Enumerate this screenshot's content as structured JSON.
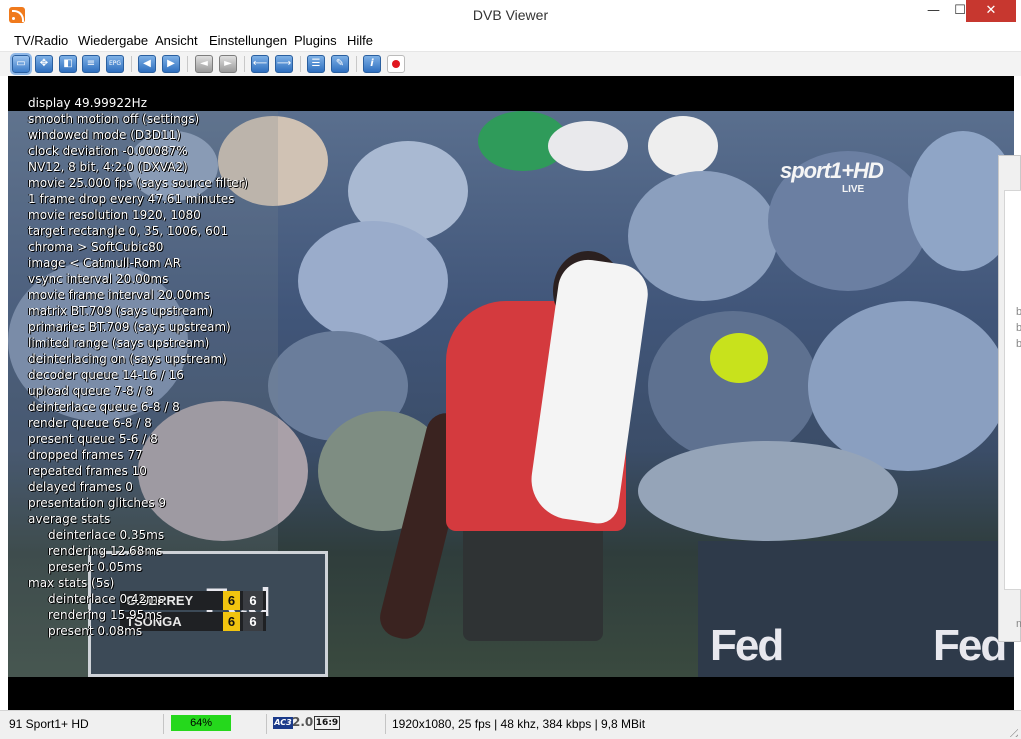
{
  "window": {
    "title": "DVB Viewer",
    "controls": {
      "minimize": "—",
      "maximize": "☐",
      "close": "✕"
    }
  },
  "menu": [
    "TV/Radio",
    "Wiedergabe",
    "Ansicht",
    "Einstellungen",
    "Plugins",
    "Hilfe"
  ],
  "toolbar": {
    "buttons": [
      {
        "icon": "window-mode-icon",
        "glyph": "▭"
      },
      {
        "icon": "fullscreen-icon",
        "glyph": "✥"
      },
      {
        "icon": "desktop-icon",
        "glyph": "◧"
      },
      {
        "icon": "osd-icon",
        "glyph": "≡"
      },
      {
        "icon": "epg-icon",
        "glyph": "EPG"
      },
      {
        "icon": "previous-channel-icon",
        "glyph": "◀"
      },
      {
        "icon": "next-channel-icon",
        "glyph": "▶"
      },
      {
        "icon": "audio-down-icon",
        "glyph": "◄"
      },
      {
        "icon": "audio-up-icon",
        "glyph": "►"
      },
      {
        "icon": "back-icon",
        "glyph": "⟵"
      },
      {
        "icon": "forward-icon",
        "glyph": "⟶"
      },
      {
        "icon": "channel-list-icon",
        "glyph": "☰"
      },
      {
        "icon": "options-icon",
        "glyph": "✎"
      },
      {
        "icon": "info-icon",
        "glyph": "i"
      },
      {
        "icon": "record-icon",
        "glyph": ""
      }
    ]
  },
  "video": {
    "channel_logo": "sport1+HD",
    "channel_live": "LIVE",
    "sponsor": "Fed",
    "sponsor_left": "Fed",
    "scoreboard": [
      {
        "name": "G.SERREY",
        "set": "6",
        "game": "6"
      },
      {
        "name": "TSONGA",
        "set": "6",
        "game": "6"
      }
    ],
    "osd_lines": [
      "display 49.99922Hz",
      "smooth motion off (settings)",
      "windowed mode (D3D11)",
      "clock deviation -0.00087%",
      "NV12, 8 bit, 4:2:0 (DXVA2)",
      "movie 25.000 fps  (says source filter)",
      "1 frame drop every 47.61 minutes",
      "movie resolution 1920, 1080",
      "target rectangle 0, 35, 1006, 601",
      "chroma > SoftCubic80",
      "image < Catmull-Rom AR",
      "vsync interval 20.00ms",
      "movie frame interval 20.00ms",
      "matrix BT.709 (says upstream)",
      "primaries BT.709 (says upstream)",
      "limited range (says upstream)",
      "deinterlacing on (says upstream)",
      "decoder queue 14-16 / 16",
      "upload queue 7-8 / 8",
      "deinterlace queue 6-8 / 8",
      "render queue 6-8 / 8",
      "present queue 5-6 / 8",
      "dropped frames 77",
      "repeated frames 10",
      "delayed frames 0",
      "presentation glitches 9",
      "average stats"
    ],
    "osd_avg": [
      "deinterlace 0.35ms",
      "rendering 12.68ms",
      "present 0.05ms"
    ],
    "osd_max_header": "max stats (5s)",
    "osd_max": [
      "deinterlace 0.42ms",
      "rendering 15.95ms",
      "present 0.08ms"
    ]
  },
  "side_panel": {
    "labels": [
      "b",
      "b",
      "b",
      "m"
    ]
  },
  "status": {
    "channel": "91 Sport1+ HD",
    "signal": "64%",
    "signal_level": 0.64,
    "audio": "AC3",
    "audio_channels": "2.0",
    "aspect": "16:9",
    "stream_info": "1920x1080, 25 fps | 48 khz, 384 kbps | 9,8 MBit"
  }
}
